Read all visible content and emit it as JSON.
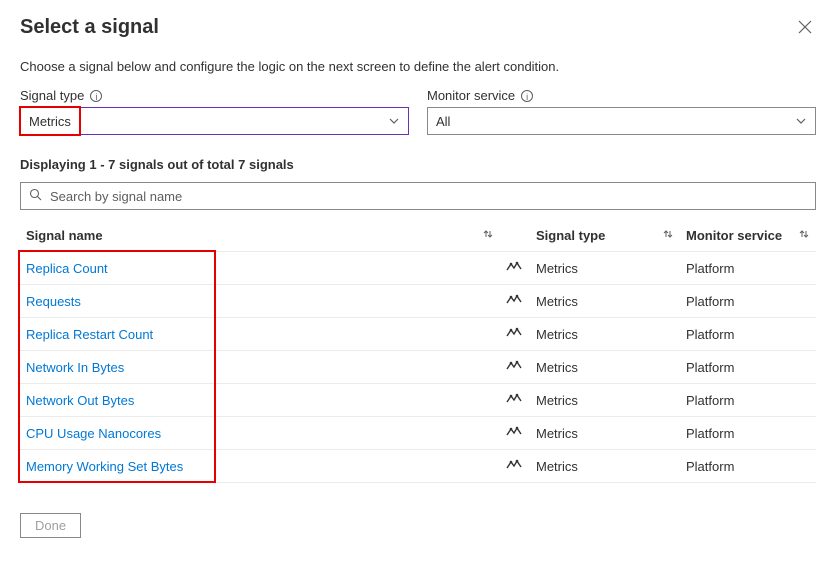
{
  "header": {
    "title": "Select a signal",
    "subtitle": "Choose a signal below and configure the logic on the next screen to define the alert condition."
  },
  "filters": {
    "signal_type": {
      "label": "Signal type",
      "value": "Metrics"
    },
    "monitor_service": {
      "label": "Monitor service",
      "value": "All"
    }
  },
  "count_line": "Displaying 1 - 7 signals out of total 7 signals",
  "search": {
    "placeholder": "Search by signal name"
  },
  "columns": {
    "name": "Signal name",
    "type": "Signal type",
    "service": "Monitor service"
  },
  "rows": [
    {
      "name": "Replica Count",
      "type": "Metrics",
      "service": "Platform"
    },
    {
      "name": "Requests",
      "type": "Metrics",
      "service": "Platform"
    },
    {
      "name": "Replica Restart Count",
      "type": "Metrics",
      "service": "Platform"
    },
    {
      "name": "Network In Bytes",
      "type": "Metrics",
      "service": "Platform"
    },
    {
      "name": "Network Out Bytes",
      "type": "Metrics",
      "service": "Platform"
    },
    {
      "name": "CPU Usage Nanocores",
      "type": "Metrics",
      "service": "Platform"
    },
    {
      "name": "Memory Working Set Bytes",
      "type": "Metrics",
      "service": "Platform"
    }
  ],
  "done_label": "Done"
}
